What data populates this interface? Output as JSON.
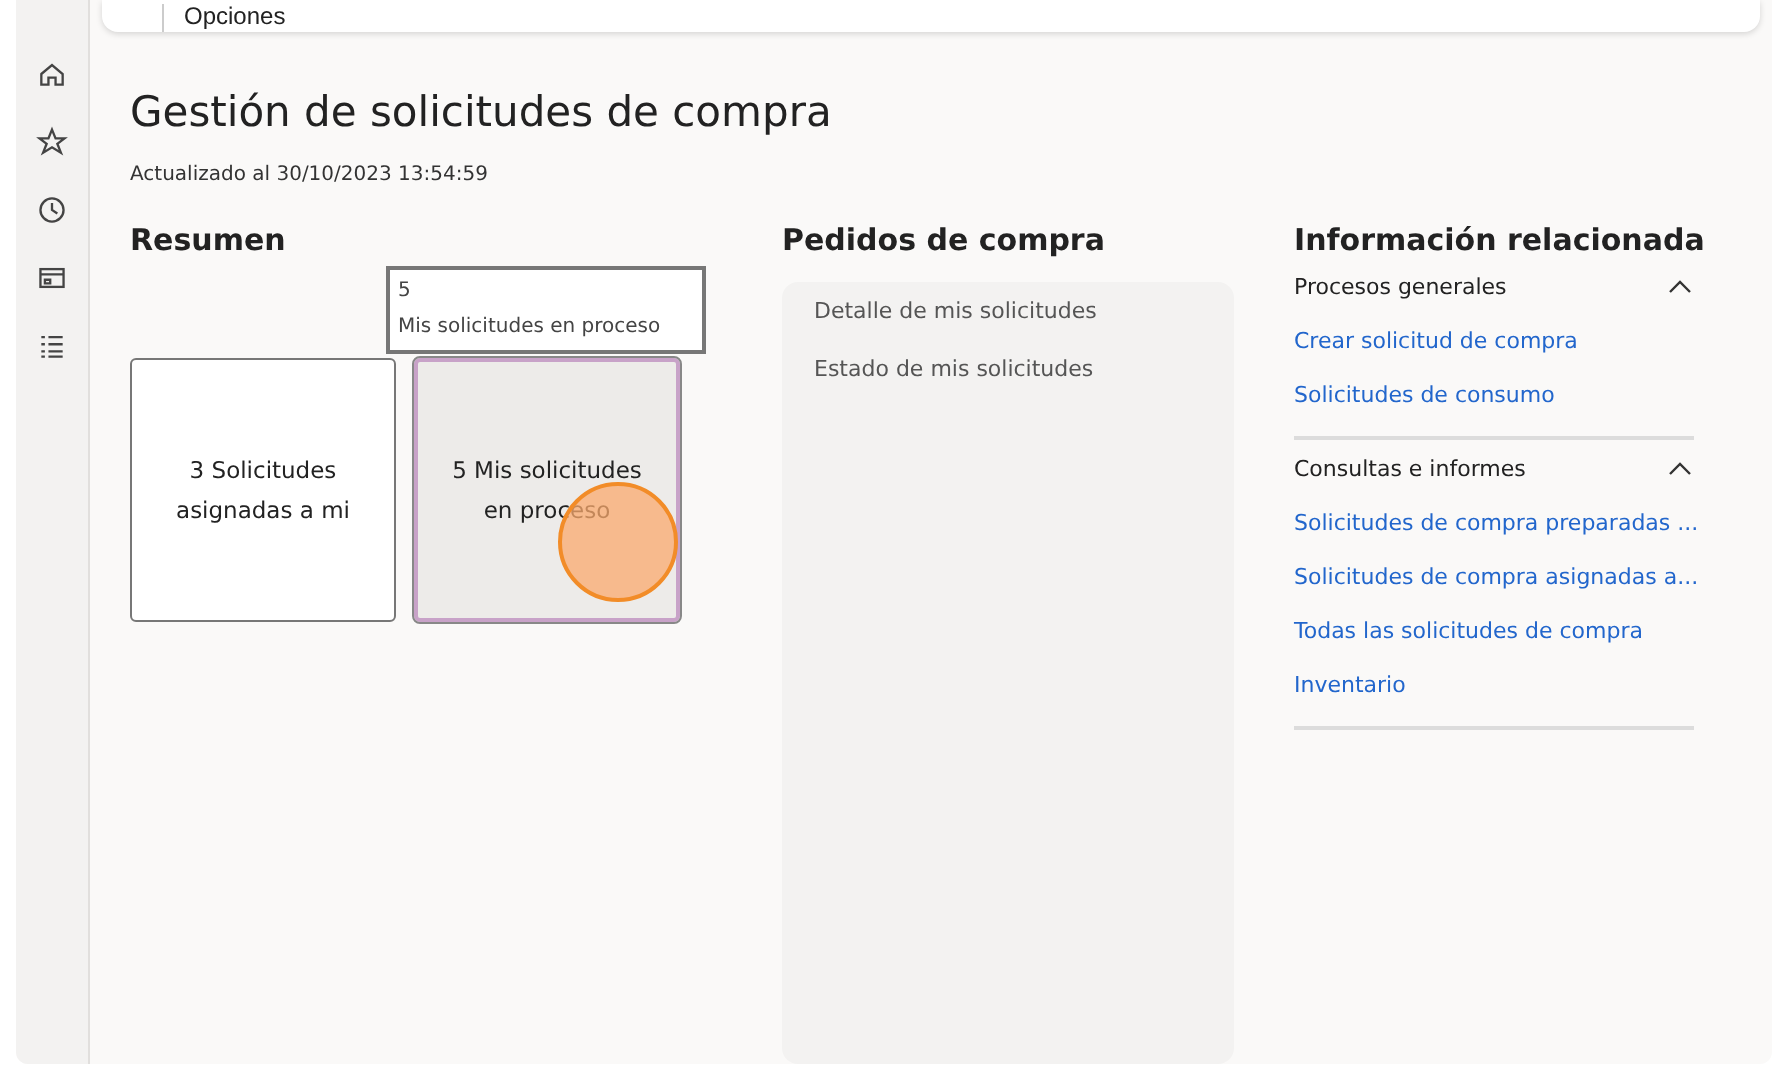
{
  "toolbar": {
    "label": "Opciones"
  },
  "page": {
    "title": "Gestión de solicitudes de compra",
    "updated": "Actualizado al 30/10/2023 13:54:59"
  },
  "summary": {
    "heading": "Resumen",
    "tooltip": {
      "count": "5",
      "label": "Mis solicitudes en proceso"
    },
    "tiles": [
      {
        "label": "3 Solicitudes asignadas a mi",
        "highlighted": false
      },
      {
        "label": "5 Mis solicitudes en proceso",
        "highlighted": true
      }
    ]
  },
  "orders": {
    "heading": "Pedidos de compra",
    "items": [
      "Detalle de mis solicitudes",
      "Estado de mis solicitudes"
    ]
  },
  "related": {
    "heading": "Información relacionada",
    "groups": [
      {
        "title": "Procesos generales",
        "expanded": true,
        "links": [
          "Crear solicitud de compra",
          "Solicitudes de consumo"
        ]
      },
      {
        "title": "Consultas e informes",
        "expanded": true,
        "links": [
          "Solicitudes de compra preparadas ...",
          "Solicitudes de compra asignadas a...",
          "Todas las solicitudes de compra",
          "Inventario"
        ]
      }
    ]
  }
}
